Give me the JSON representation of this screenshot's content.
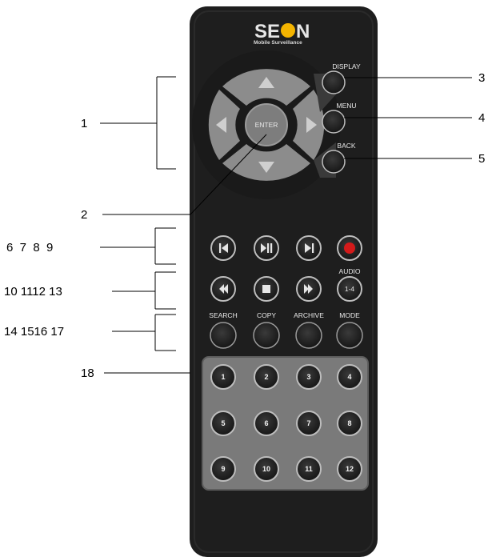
{
  "remote": {
    "brand": {
      "prefix": "SE",
      "suffix": "N",
      "tagline": "Mobile Surveillance"
    },
    "buttons": {
      "enter": "ENTER",
      "display": "DISPLAY",
      "menu": "MENU",
      "back": "BACK",
      "audio_top": "AUDIO",
      "audio_range": "1-4",
      "search": "SEARCH",
      "copy": "COPY",
      "archive": "ARCHIVE",
      "mode": "MODE"
    },
    "keypad": [
      "1",
      "2",
      "3",
      "4",
      "5",
      "6",
      "7",
      "8",
      "9",
      "10",
      "11",
      "12"
    ]
  },
  "callouts": {
    "c1": "1",
    "c2": "2",
    "c3": "3",
    "c4": "4",
    "c5": "5",
    "c6_9": "6  7  8  9",
    "c10_13": "10 1112 13",
    "c14_17": "14 1516 17",
    "c18": "18"
  },
  "colors": {
    "body": "#1e1e1e",
    "button": "#2b2b2b",
    "button_ring": "#bdbdbd",
    "dpad": "#8c8c8c",
    "keypad_panel": "#7a7a7a",
    "record": "#d41a1a",
    "logo_dot": "#f4b400"
  }
}
